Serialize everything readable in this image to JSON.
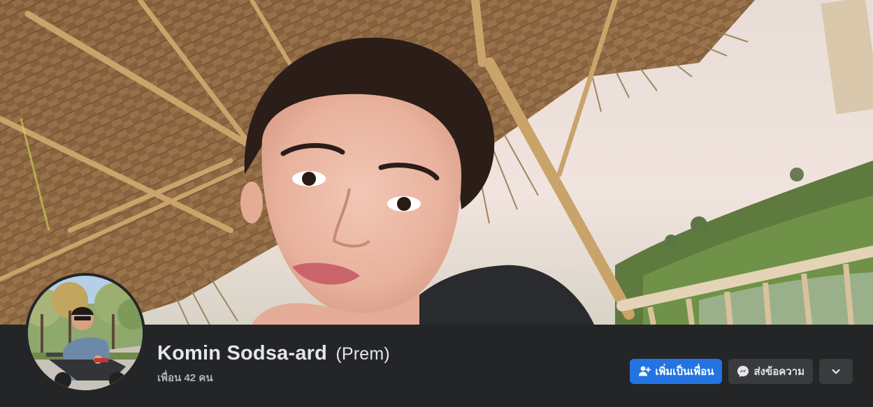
{
  "profile": {
    "name": "Komin Sodsa-ard",
    "alternate_name": "(Prem)",
    "friends_count": "เพื่อน 42 คน"
  },
  "actions": {
    "add_friend_label": "เพิ่มเป็นเพื่อน",
    "message_label": "ส่งข้อความ"
  },
  "icons": {
    "add_friend": "add-friend-icon",
    "message": "messenger-icon",
    "more": "chevron-down-icon"
  },
  "colors": {
    "background": "#242526",
    "primary_button": "#2374e1",
    "secondary_button": "#3a3b3c",
    "name_text": "#e4e6eb",
    "secondary_text": "#b0b3b8"
  }
}
